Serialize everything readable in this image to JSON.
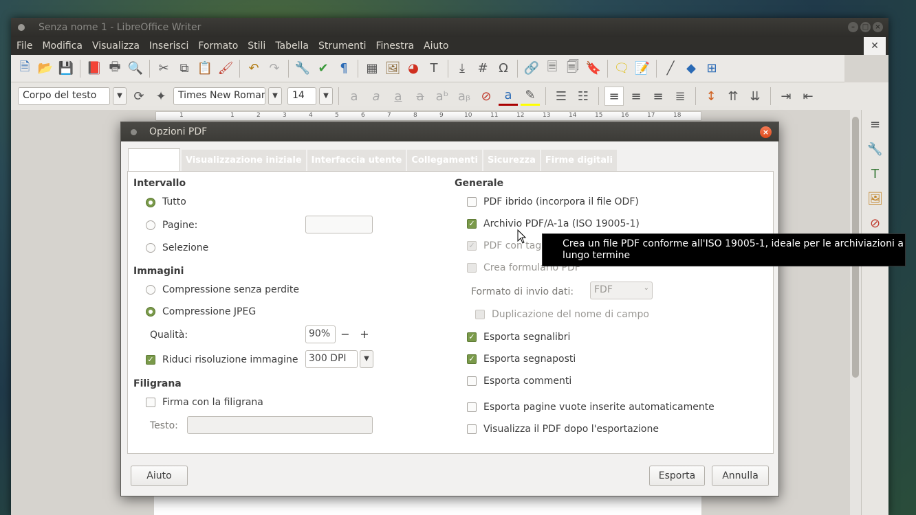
{
  "window": {
    "title": "Senza nome 1 - LibreOffice Writer",
    "menu": [
      "File",
      "Modifica",
      "Visualizza",
      "Inserisci",
      "Formato",
      "Stili",
      "Tabella",
      "Strumenti",
      "Finestra",
      "Aiuto"
    ],
    "close_doc": "✕"
  },
  "formatting": {
    "paragraph_style": "Corpo del testo",
    "font_name": "Times New Roman",
    "font_size": "14"
  },
  "ruler": {
    "ticks": [
      "1",
      "1",
      "2",
      "3",
      "4",
      "5",
      "6",
      "7",
      "8",
      "9",
      "10",
      "11",
      "12",
      "13",
      "14",
      "15",
      "16",
      "17",
      "18"
    ]
  },
  "dialog": {
    "title": "Opzioni PDF",
    "tabs": [
      "",
      "Visualizzazione iniziale",
      "Interfaccia utente",
      "Collegamenti",
      "Sicurezza",
      "Firme digitali"
    ],
    "range": {
      "heading": "Intervallo",
      "all": "Tutto",
      "pages": "Pagine:",
      "pages_value": "",
      "selection": "Selezione"
    },
    "images": {
      "heading": "Immagini",
      "lossless": "Compressione senza perdite",
      "jpeg": "Compressione JPEG",
      "quality_label": "Qualità:",
      "quality_value": "90%",
      "minus": "−",
      "plus": "+",
      "reduce_label": "Riduci risoluzione immagine",
      "reduce_value": "300 DPI"
    },
    "watermark": {
      "heading": "Filigrana",
      "sign": "Firma con la filigrana",
      "text_label": "Testo:",
      "text_value": ""
    },
    "general": {
      "heading": "Generale",
      "hybrid": "PDF ibrido (incorpora il file ODF)",
      "archive": "Archivio PDF/A-1a (ISO 19005-1)",
      "tagged": "PDF con tag (",
      "form": "Crea formulario PDF",
      "submit_label": "Formato di invio dati:",
      "submit_value": "FDF",
      "dup_fields": "Duplicazione del nome di campo",
      "bookmarks": "Esporta segnalibri",
      "placeholders": "Esporta segnaposti",
      "comments": "Esporta commenti",
      "empty_pages": "Esporta pagine vuote inserite automaticamente",
      "view_after": "Visualizza il PDF dopo l'esportazione"
    },
    "buttons": {
      "help": "Aiuto",
      "export": "Esporta",
      "cancel": "Annulla"
    },
    "tooltip": "Crea un file PDF conforme all'ISO 19005-1, ideale per le archiviazioni a lungo termine"
  },
  "colors": {
    "accent_green": "#7a9a4a",
    "close_orange": "#df4a1a",
    "titlebar": "#3c3b37"
  }
}
